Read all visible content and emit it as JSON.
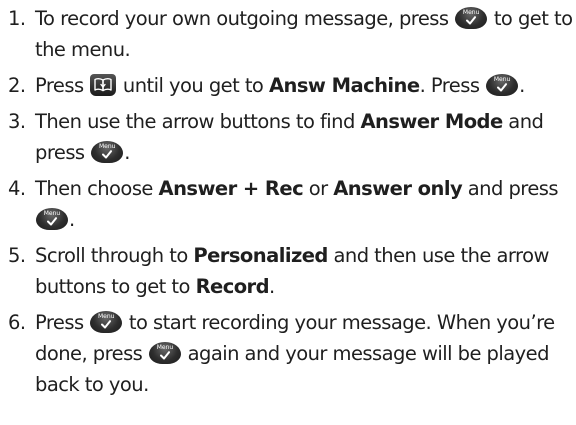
{
  "steps": [
    {
      "num": "1.",
      "text": {
        "a": "To record your own outgoing message, press",
        "b": "to get to the menu."
      }
    },
    {
      "num": "2.",
      "text": {
        "a": "Press",
        "b": "until you get to",
        "bold": "Answ Machine",
        "c": ". Press",
        "d": "."
      }
    },
    {
      "num": "3.",
      "text": {
        "a": "Then use the arrow buttons to find",
        "bold": "Answer Mode",
        "b": "and press",
        "c": "."
      }
    },
    {
      "num": "4.",
      "text": {
        "a": "Then choose",
        "bold1": "Answer + Rec",
        "b": "or",
        "bold2": "Answer only",
        "c": "and press",
        "d": "."
      }
    },
    {
      "num": "5.",
      "text": {
        "a": "Scroll through to",
        "bold1": "Personalized",
        "b": "and then use the arrow buttons to get to",
        "bold2": "Record",
        "c": "."
      }
    },
    {
      "num": "6.",
      "text": {
        "a": "Press",
        "b": "to start recording your message. When you’re done, press",
        "c": "again and your message will be played back to you."
      }
    }
  ],
  "icons": {
    "menu_key": {
      "name": "menu-ok-key-icon",
      "label": "Menu"
    },
    "phonebook_key": {
      "name": "phonebook-key-icon"
    }
  }
}
